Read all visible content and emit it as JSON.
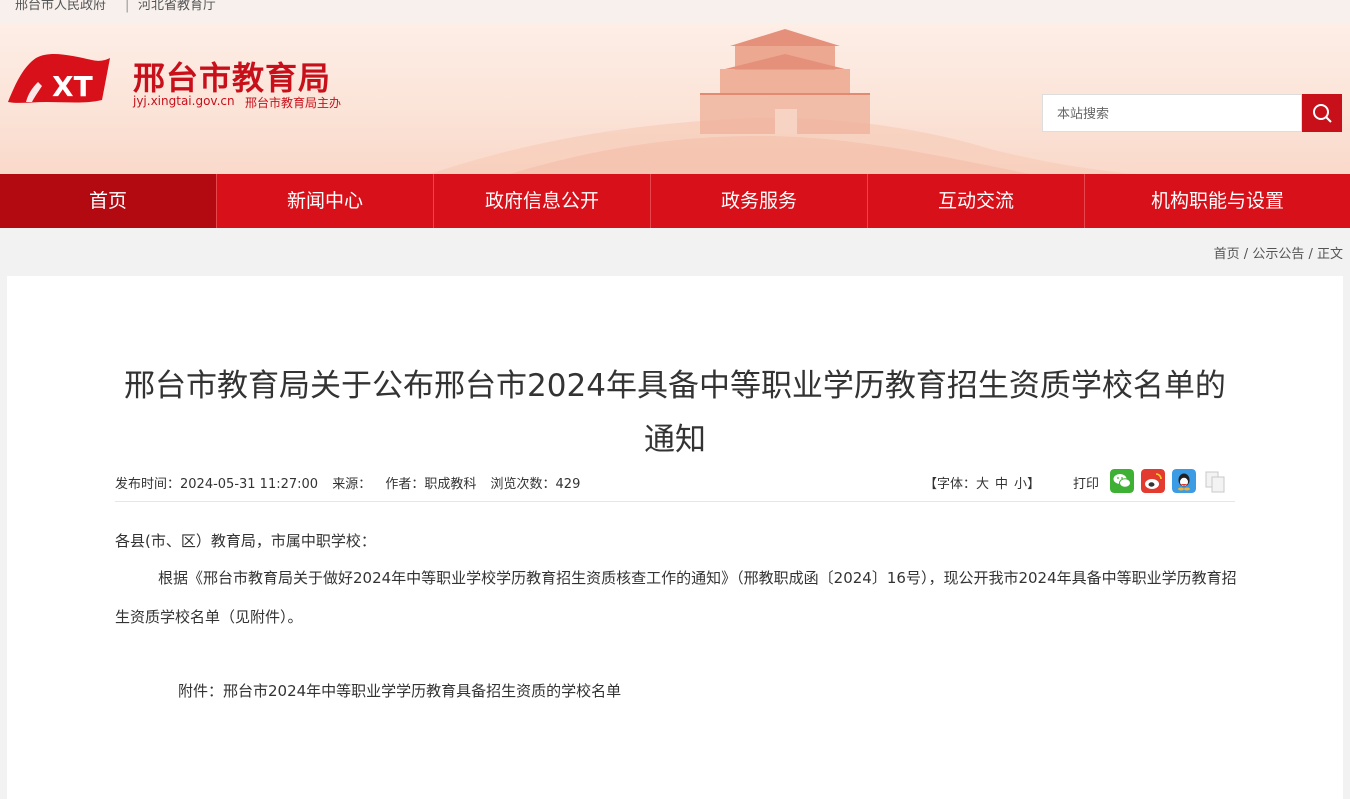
{
  "topbar": {
    "link1": "邢台市人民政府",
    "separator": "|",
    "link2": "河北省教育厅"
  },
  "header": {
    "site_title": "邢台市教育局",
    "url": "jyj.xingtai.gov.cn",
    "host": "邢台市教育局主办",
    "emblem_text": "XT",
    "search_placeholder": "本站搜索",
    "search_icon": "search-icon"
  },
  "nav": {
    "items": [
      "首页",
      "新闻中心",
      "政府信息公开",
      "政务服务",
      "互动交流",
      "机构职能与设置"
    ],
    "active_index": 0
  },
  "breadcrumb": {
    "home": "首页",
    "section": "公示公告",
    "current": "正文",
    "sep": " / "
  },
  "article": {
    "title": "邢台市教育局关于公布邢台市2024年具备中等职业学历教育招生资质学校名单的通知",
    "meta": {
      "publish_time": "发布时间：2024-05-31 11:27:00",
      "source": "来源：",
      "author": "作者：职成教科",
      "views": "浏览次数：429"
    },
    "font_size": {
      "label_open": "【字体：",
      "large": "大",
      "medium": "中",
      "small": "小",
      "label_close": "】"
    },
    "print_label": "打印",
    "share_icons": [
      "wechat-icon",
      "weibo-icon",
      "qq-icon",
      "copy-icon"
    ],
    "salutation": "各县(市、区）教育局，市属中职学校：",
    "paragraph": "根据《邢台市教育局关于做好2024年中等职业学校学历教育招生资质核查工作的通知》（邢教职成函〔2024〕16号），现公开我市2024年具备中等职业学历教育招生资质学校名单（见附件）。",
    "attachment": "附件：邢台市2024年中等职业学学历教育具备招生资质的学校名单"
  },
  "colors": {
    "brand_red": "#d7101a",
    "nav_active": "#b30a12",
    "header_bg": "#fbe3d7"
  }
}
